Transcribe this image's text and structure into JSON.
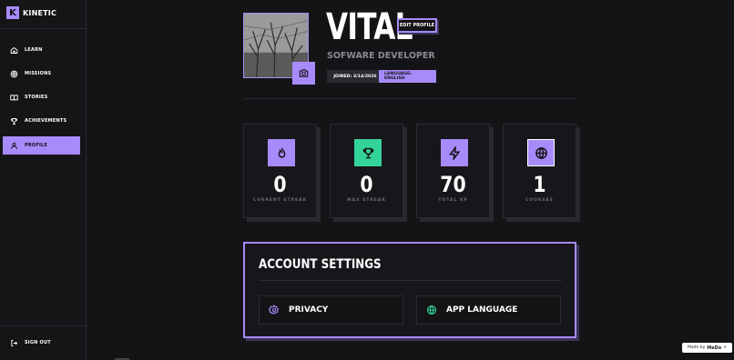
{
  "brand": {
    "mark": "K",
    "name": "KINETIC"
  },
  "nav": {
    "items": [
      {
        "label": "LEARN",
        "icon": "home-icon",
        "active": false
      },
      {
        "label": "MISSIONS",
        "icon": "target-icon",
        "active": false
      },
      {
        "label": "STORIES",
        "icon": "book-icon",
        "active": false
      },
      {
        "label": "ACHIEVEMENTS",
        "icon": "trophy-icon",
        "active": false
      },
      {
        "label": "PROFILE",
        "icon": "user-icon",
        "active": true
      }
    ],
    "sign_out": "SIGN OUT"
  },
  "profile": {
    "name": "VITAL",
    "edit_label": "EDIT PROFILE",
    "role": "SOFWARE DEVELOPER",
    "joined": "JOINED: 3/14/2026",
    "language": "LANGUAGE: ENGLISH"
  },
  "stats": [
    {
      "value": "0",
      "label": "CURRENT STREAK",
      "icon": "flame-icon",
      "color": "#a78bfa"
    },
    {
      "value": "0",
      "label": "MAX STREAK",
      "icon": "trophy-icon",
      "color": "#34d399"
    },
    {
      "value": "70",
      "label": "TOTAL XP",
      "icon": "bolt-icon",
      "color": "#a78bfa"
    },
    {
      "value": "1",
      "label": "COURSES",
      "icon": "globe-icon",
      "color": "#a78bfa"
    }
  ],
  "settings": {
    "title": "ACCOUNT SETTINGS",
    "privacy": "PRIVACY",
    "app_language": "APP LANGUAGE"
  },
  "badge": {
    "made_by": "Made by",
    "brand": "MeDo"
  },
  "colors": {
    "accent": "#a78bfa",
    "green": "#34d399",
    "background": "#141316"
  }
}
